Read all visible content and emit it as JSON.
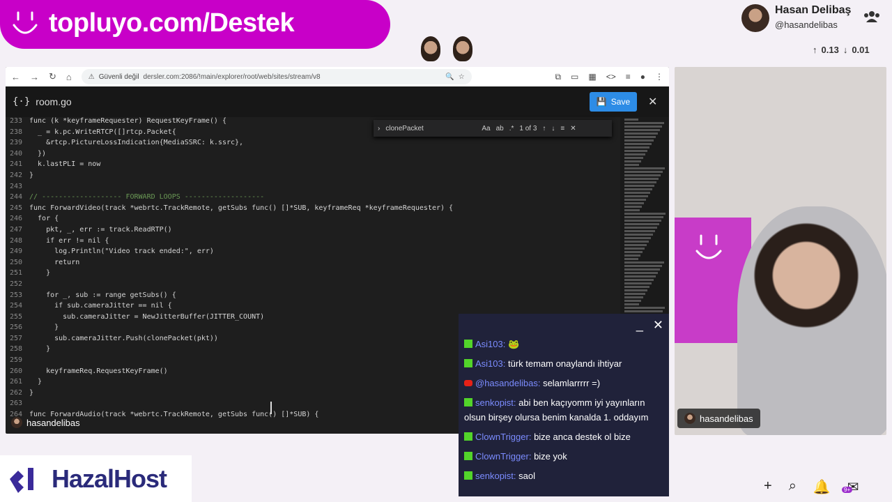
{
  "banner": {
    "text": "topluyo.com/Destek"
  },
  "streamer": {
    "name": "Hasan Delibaş",
    "handle": "@hasandelibas",
    "up": "0.13",
    "down": "0.01"
  },
  "browser": {
    "security": "Güvenli değil",
    "url": "dersler.com:2086/!main/explorer/root/web/sites/stream/v8"
  },
  "editor": {
    "filename": "room.go",
    "save_label": "Save",
    "find_query": "clonePacket",
    "find_count": "1 of 3",
    "lines": [
      {
        "n": "233",
        "t": "func (k *keyframeRequester) RequestKeyFrame() {"
      },
      {
        "n": "238",
        "t": "  _ = k.pc.WriteRTCP([]rtcp.Packet{"
      },
      {
        "n": "239",
        "t": "    &rtcp.PictureLossIndication{MediaSSRC: k.ssrc},"
      },
      {
        "n": "240",
        "t": "  })"
      },
      {
        "n": "241",
        "t": "  k.lastPLI = now"
      },
      {
        "n": "242",
        "t": "}"
      },
      {
        "n": "243",
        "t": ""
      },
      {
        "n": "244",
        "t": "// ------------------- FORWARD LOOPS -------------------"
      },
      {
        "n": "245",
        "t": "func ForwardVideo(track *webrtc.TrackRemote, getSubs func() []*SUB, keyframeReq *keyframeRequester) {"
      },
      {
        "n": "246",
        "t": "  for {"
      },
      {
        "n": "247",
        "t": "    pkt, _, err := track.ReadRTP()"
      },
      {
        "n": "248",
        "t": "    if err != nil {"
      },
      {
        "n": "249",
        "t": "      log.Println(\"Video track ended:\", err)"
      },
      {
        "n": "250",
        "t": "      return"
      },
      {
        "n": "251",
        "t": "    }"
      },
      {
        "n": "252",
        "t": ""
      },
      {
        "n": "253",
        "t": "    for _, sub := range getSubs() {"
      },
      {
        "n": "254",
        "t": "      if sub.cameraJitter == nil {"
      },
      {
        "n": "255",
        "t": "        sub.cameraJitter = NewJitterBuffer(JITTER_COUNT)"
      },
      {
        "n": "256",
        "t": "      }"
      },
      {
        "n": "257",
        "t": "      sub.cameraJitter.Push(clonePacket(pkt))"
      },
      {
        "n": "258",
        "t": "    }"
      },
      {
        "n": "259",
        "t": ""
      },
      {
        "n": "260",
        "t": "    keyframeReq.RequestKeyFrame()"
      },
      {
        "n": "261",
        "t": "  }"
      },
      {
        "n": "262",
        "t": "}"
      },
      {
        "n": "263",
        "t": ""
      },
      {
        "n": "264",
        "t": "func ForwardAudio(track *webrtc.TrackRemote, getSubs func() []*SUB) {"
      }
    ]
  },
  "overlay_user": "hasandelibas",
  "cam_tag": "hasandelibas",
  "chat": [
    {
      "u": "Asi103:",
      "m": "🐸",
      "src": "kick"
    },
    {
      "u": "Asi103:",
      "m": "türk temam onaylandı ihtiyar",
      "src": "kick"
    },
    {
      "u": "@hasandelibas:",
      "m": "selamlarrrrr =)",
      "src": "yt"
    },
    {
      "u": "senkopist:",
      "m": "abi ben kaçıyomm iyi yayınların olsun birşey olursa benim kanalda 1. oddayım",
      "src": "kick"
    },
    {
      "u": "ClownTrigger:",
      "m": "bize anca destek ol bize",
      "src": "kick"
    },
    {
      "u": "ClownTrigger:",
      "m": "bize yok",
      "src": "kick"
    },
    {
      "u": "senkopist:",
      "m": "saol",
      "src": "kick"
    }
  ],
  "sponsor": "HazalHost",
  "notif_badge": "9+"
}
